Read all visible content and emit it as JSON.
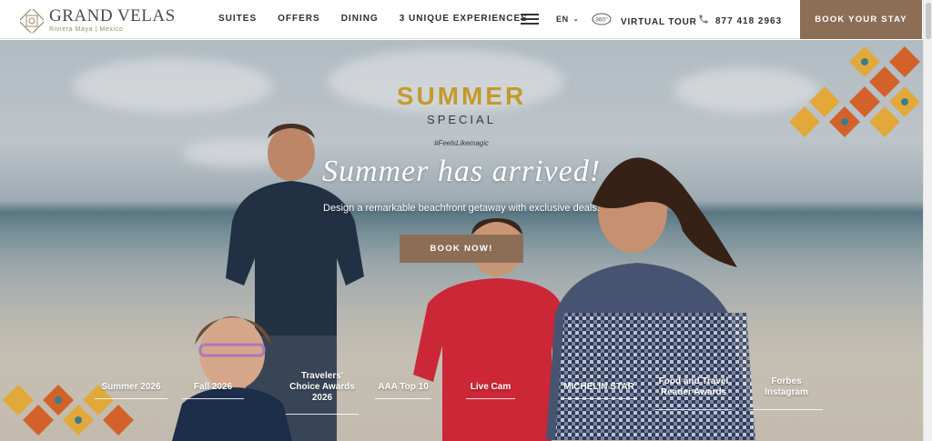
{
  "brand": {
    "name": "GRAND VELAS",
    "subtitle": "Riviera Maya  |  Mexico",
    "logo_icon": "logo-emblem-icon"
  },
  "nav": {
    "items": [
      "SUITES",
      "OFFERS",
      "DINING",
      "3 UNIQUE EXPERIENCES"
    ],
    "menu_icon": "hamburger-menu-icon",
    "language": "EN",
    "tour_icon_text": "360°",
    "tour_label": "VIRTUAL TOUR",
    "phone": "877 418 2963",
    "book_label": "BOOK YOUR STAY"
  },
  "hero": {
    "title": "SUMMER",
    "special": "SPECIAL",
    "tagline": "#FeelsLikemagic",
    "headline": "Summer has arrived!",
    "subheadline": "Design a remarkable beachfront getaway with exclusive deals.",
    "cta": "BOOK NOW!"
  },
  "awards": [
    {
      "label": "Summer 2026"
    },
    {
      "label": "Fall 2026"
    },
    {
      "label": "Travelers' Choice Awards 2026"
    },
    {
      "label": "AAA Top 10"
    },
    {
      "label": "Live Cam"
    },
    {
      "label": "MICHELIN STAR"
    },
    {
      "label": "Food and Travel Reader Awards"
    },
    {
      "label": "Forbes Instagram"
    }
  ],
  "colors": {
    "accent_brown": "#8c6e57",
    "summer_gold": "#c49a2a",
    "tile_orange": "#d2622a",
    "tile_yellow": "#e2a93a"
  }
}
